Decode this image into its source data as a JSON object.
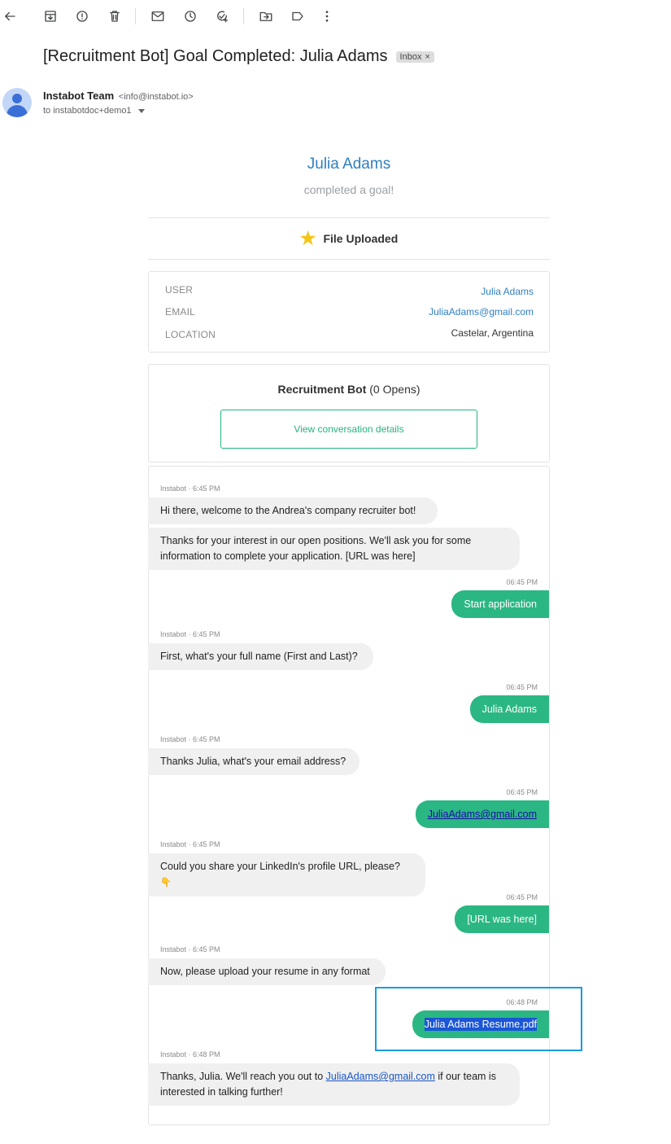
{
  "toolbar": {
    "icons": [
      "back-arrow-icon",
      "archive-icon",
      "report-spam-icon",
      "delete-icon",
      "mark-unread-icon",
      "snooze-icon",
      "add-task-icon",
      "move-to-icon",
      "label-icon",
      "more-icon"
    ]
  },
  "email": {
    "subject": "[Recruitment Bot] Goal Completed: Julia Adams",
    "label_chip": "Inbox",
    "label_chip_close": "×",
    "sender_name": "Instabot Team",
    "sender_email": "<info@instabot.io>",
    "to_line": "to instabotdoc+demo1"
  },
  "hero": {
    "name": "Julia Adams",
    "subtitle": "completed a goal!",
    "goal": "File Uploaded"
  },
  "info": {
    "rows": [
      {
        "key": "USER",
        "value": "Julia Adams"
      },
      {
        "key": "EMAIL",
        "value": "JuliaAdams@gmail.com"
      },
      {
        "key": "LOCATION",
        "value": "Castelar, Argentina"
      }
    ]
  },
  "bot": {
    "name": "Recruitment Bot",
    "opens": "(0 Opens)",
    "view_button": "View conversation details"
  },
  "conversation": {
    "bot_ts_1": "Instabot · 6:45 PM",
    "bot_msg_1": "Hi there, welcome to the Andrea's company recruiter bot!",
    "bot_msg_2": "Thanks for your interest in our open positions. We'll ask you for some information to complete your application. [URL was here]",
    "user_ts_1": "06:45 PM",
    "user_msg_1": "Start application",
    "bot_ts_2": "Instabot · 6:45 PM",
    "bot_msg_3": "First, what's your full name (First and Last)?",
    "user_ts_2": "06:45 PM",
    "user_msg_2": "Julia Adams",
    "bot_ts_3": "Instabot · 6:45 PM",
    "bot_msg_4": "Thanks Julia, what's your email address?",
    "user_ts_3": "06:45 PM",
    "user_msg_3": "JuliaAdams@gmail.com",
    "bot_ts_4": "Instabot · 6:45 PM",
    "bot_msg_5": "Could you share your LinkedIn's profile URL, please?",
    "bot_msg_5_emoji": "👇",
    "user_ts_4": "06:45 PM",
    "user_msg_4": "[URL was here]",
    "bot_ts_5": "Instabot · 6:45 PM",
    "bot_msg_6": "Now, please upload your resume in any format",
    "user_ts_5": "06:48 PM",
    "user_msg_5": "Julia Adams Resume.pdf",
    "bot_ts_6": "Instabot · 6:48 PM",
    "bot_msg_7_a": "Thanks, Julia. We'll reach you out to",
    "bot_msg_7_link": "JuliaAdams@gmail.com",
    "bot_msg_7_b": "if our team is interested in talking further!"
  },
  "colors": {
    "accent_blue": "#2f7fc1",
    "bot_green": "#2bb783",
    "button_green": "#23b47e",
    "highlight_box": "#1a9be0"
  }
}
